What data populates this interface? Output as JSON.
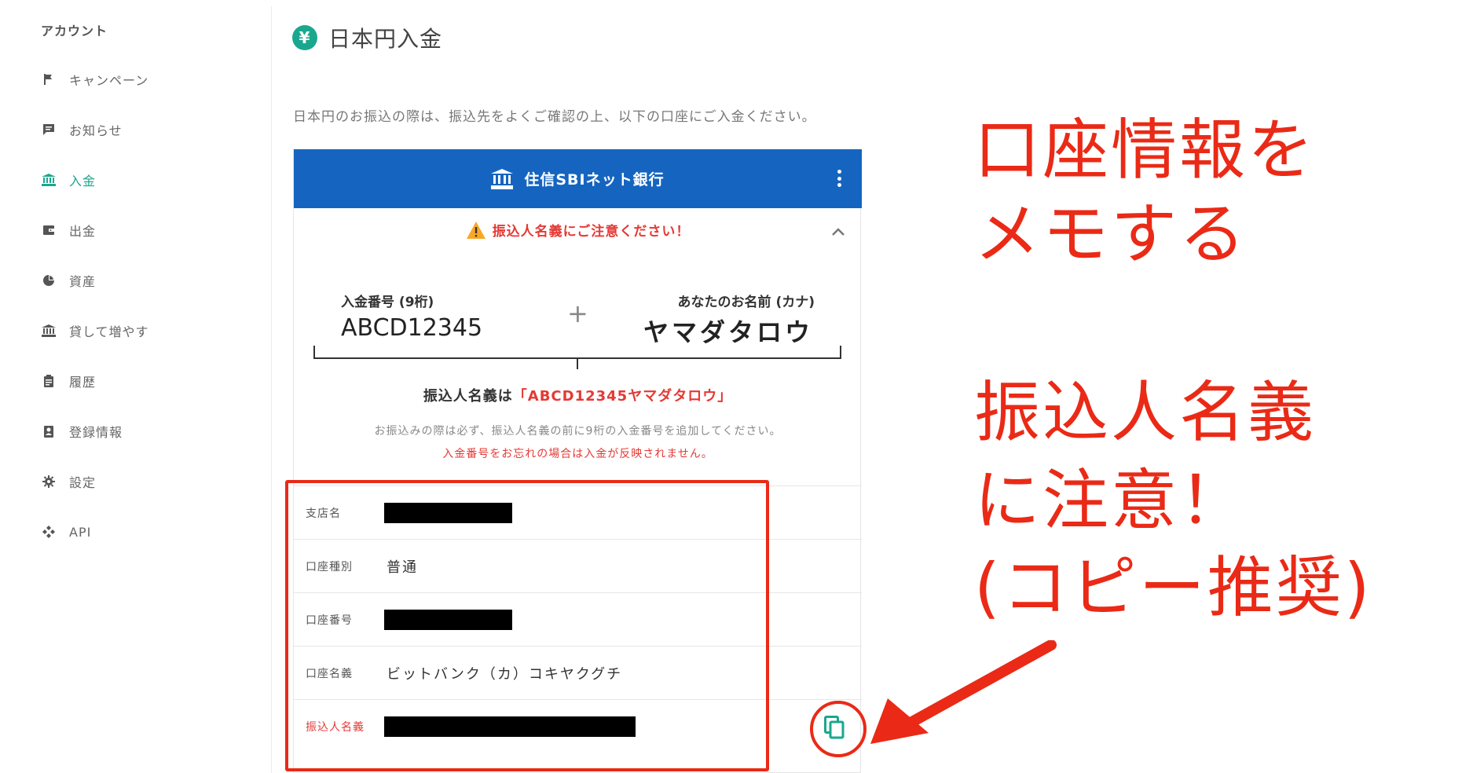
{
  "sidebar": {
    "heading": "アカウント",
    "items": [
      {
        "label": "キャンペーン",
        "icon": "flag-icon",
        "active": false
      },
      {
        "label": "お知らせ",
        "icon": "message-icon",
        "active": false
      },
      {
        "label": "入金",
        "icon": "bank-icon",
        "active": true
      },
      {
        "label": "出金",
        "icon": "wallet-icon",
        "active": false
      },
      {
        "label": "資産",
        "icon": "pie-chart-icon",
        "active": false
      },
      {
        "label": "貸して増やす",
        "icon": "bank-icon",
        "active": false
      },
      {
        "label": "履歴",
        "icon": "clipboard-icon",
        "active": false
      },
      {
        "label": "登録情報",
        "icon": "id-card-icon",
        "active": false
      },
      {
        "label": "設定",
        "icon": "gear-icon",
        "active": false
      },
      {
        "label": "API",
        "icon": "api-icon",
        "active": false
      }
    ]
  },
  "header": {
    "icon_glyph": "¥",
    "title": "日本円入金"
  },
  "instruction": "日本円のお振込の際は、振込先をよくご確認の上、以下の口座にご入金ください。",
  "bank": {
    "name": "住信SBIネット銀行",
    "warning": "振込人名義にご注意ください！",
    "deposit_number_label": "入金番号 (9桁)",
    "deposit_number": "ABCD12345",
    "plus": "+",
    "your_name_label": "あなたのお名前 (カナ)",
    "your_name": "ヤマダタロウ",
    "payer_prefix": "振込人名義は",
    "payer_value": "「ABCD12345ヤマダタロウ」",
    "note_main": "お振込みの際は必ず、振込人名義の前に9桁の入金番号を追加してください。",
    "note_warning": "入金番号をお忘れの場合は入金が反映されません。",
    "rows": [
      {
        "label": "支店名",
        "value": "",
        "redacted": true
      },
      {
        "label": "口座種別",
        "value": "普通",
        "redacted": false
      },
      {
        "label": "口座番号",
        "value": "",
        "redacted": true
      },
      {
        "label": "口座名義",
        "value": "ビットバンク（カ）コキヤクグチ",
        "redacted": false
      },
      {
        "label": "振込人名義",
        "value": "",
        "redacted": true
      }
    ]
  },
  "annotations": {
    "memo_line1": "口座情報を",
    "memo_line2": "メモする",
    "caution_line1": "振込人名義",
    "caution_line2": "に注意！",
    "caution_line3": "(コピー推奨)"
  },
  "colors": {
    "accent": "#1aa78e",
    "bank_header": "#1565c0",
    "warning_red": "#e53935",
    "annotation_red": "#ea2a16"
  }
}
